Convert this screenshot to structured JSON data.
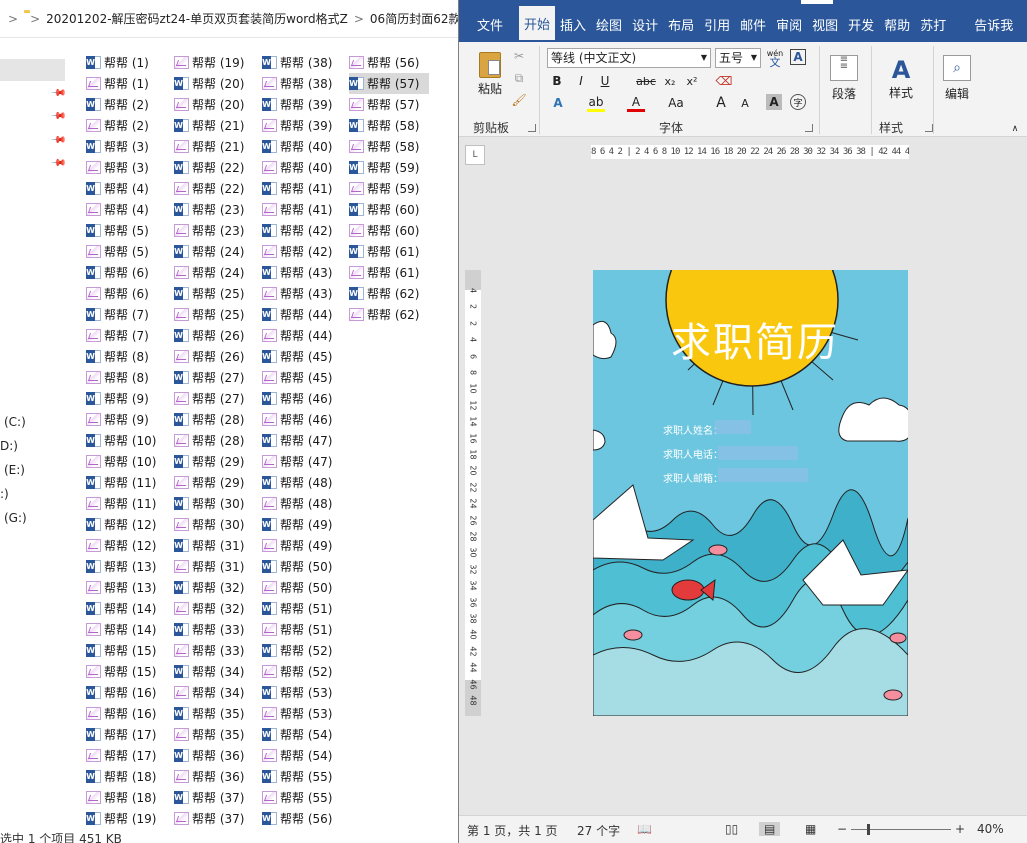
{
  "explorer": {
    "breadcrumb": [
      "20201202-解压密码zt24-单页双页套装简历word格式Z",
      "06简历封面62款"
    ],
    "drives": [
      "(C:)",
      "D:)",
      "(E:)",
      ":)",
      "(G:)"
    ],
    "status_text": "选中 1 个项目  451 KB",
    "columns": [
      [
        {
          "label": "帮帮 (1)",
          "type": "word"
        },
        {
          "label": "帮帮 (1)",
          "type": "image"
        },
        {
          "label": "帮帮 (2)",
          "type": "word"
        },
        {
          "label": "帮帮 (2)",
          "type": "image"
        },
        {
          "label": "帮帮 (3)",
          "type": "word"
        },
        {
          "label": "帮帮 (3)",
          "type": "image"
        },
        {
          "label": "帮帮 (4)",
          "type": "word"
        },
        {
          "label": "帮帮 (4)",
          "type": "image"
        },
        {
          "label": "帮帮 (5)",
          "type": "word"
        },
        {
          "label": "帮帮 (5)",
          "type": "image"
        },
        {
          "label": "帮帮 (6)",
          "type": "word"
        },
        {
          "label": "帮帮 (6)",
          "type": "image"
        },
        {
          "label": "帮帮 (7)",
          "type": "word"
        },
        {
          "label": "帮帮 (7)",
          "type": "image"
        },
        {
          "label": "帮帮 (8)",
          "type": "word"
        },
        {
          "label": "帮帮 (8)",
          "type": "image"
        },
        {
          "label": "帮帮 (9)",
          "type": "word"
        },
        {
          "label": "帮帮 (9)",
          "type": "image"
        },
        {
          "label": "帮帮 (10)",
          "type": "word"
        },
        {
          "label": "帮帮 (10)",
          "type": "image"
        },
        {
          "label": "帮帮 (11)",
          "type": "word"
        },
        {
          "label": "帮帮 (11)",
          "type": "image"
        },
        {
          "label": "帮帮 (12)",
          "type": "word"
        },
        {
          "label": "帮帮 (12)",
          "type": "image"
        },
        {
          "label": "帮帮 (13)",
          "type": "word"
        },
        {
          "label": "帮帮 (13)",
          "type": "image"
        },
        {
          "label": "帮帮 (14)",
          "type": "word"
        },
        {
          "label": "帮帮 (14)",
          "type": "image"
        },
        {
          "label": "帮帮 (15)",
          "type": "word"
        },
        {
          "label": "帮帮 (15)",
          "type": "image"
        },
        {
          "label": "帮帮 (16)",
          "type": "word"
        },
        {
          "label": "帮帮 (16)",
          "type": "image"
        },
        {
          "label": "帮帮 (17)",
          "type": "word"
        },
        {
          "label": "帮帮 (17)",
          "type": "image"
        },
        {
          "label": "帮帮 (18)",
          "type": "word"
        },
        {
          "label": "帮帮 (18)",
          "type": "image"
        },
        {
          "label": "帮帮 (19)",
          "type": "word"
        }
      ],
      [
        {
          "label": "帮帮 (19)",
          "type": "image"
        },
        {
          "label": "帮帮 (20)",
          "type": "word"
        },
        {
          "label": "帮帮 (20)",
          "type": "image"
        },
        {
          "label": "帮帮 (21)",
          "type": "word"
        },
        {
          "label": "帮帮 (21)",
          "type": "image"
        },
        {
          "label": "帮帮 (22)",
          "type": "word"
        },
        {
          "label": "帮帮 (22)",
          "type": "image"
        },
        {
          "label": "帮帮 (23)",
          "type": "word"
        },
        {
          "label": "帮帮 (23)",
          "type": "image"
        },
        {
          "label": "帮帮 (24)",
          "type": "word"
        },
        {
          "label": "帮帮 (24)",
          "type": "image"
        },
        {
          "label": "帮帮 (25)",
          "type": "word"
        },
        {
          "label": "帮帮 (25)",
          "type": "image"
        },
        {
          "label": "帮帮 (26)",
          "type": "word"
        },
        {
          "label": "帮帮 (26)",
          "type": "image"
        },
        {
          "label": "帮帮 (27)",
          "type": "word"
        },
        {
          "label": "帮帮 (27)",
          "type": "image"
        },
        {
          "label": "帮帮 (28)",
          "type": "word"
        },
        {
          "label": "帮帮 (28)",
          "type": "image"
        },
        {
          "label": "帮帮 (29)",
          "type": "word"
        },
        {
          "label": "帮帮 (29)",
          "type": "image"
        },
        {
          "label": "帮帮 (30)",
          "type": "word"
        },
        {
          "label": "帮帮 (30)",
          "type": "image"
        },
        {
          "label": "帮帮 (31)",
          "type": "word"
        },
        {
          "label": "帮帮 (31)",
          "type": "image"
        },
        {
          "label": "帮帮 (32)",
          "type": "word"
        },
        {
          "label": "帮帮 (32)",
          "type": "image"
        },
        {
          "label": "帮帮 (33)",
          "type": "word"
        },
        {
          "label": "帮帮 (33)",
          "type": "image"
        },
        {
          "label": "帮帮 (34)",
          "type": "word"
        },
        {
          "label": "帮帮 (34)",
          "type": "image"
        },
        {
          "label": "帮帮 (35)",
          "type": "word"
        },
        {
          "label": "帮帮 (35)",
          "type": "image"
        },
        {
          "label": "帮帮 (36)",
          "type": "word"
        },
        {
          "label": "帮帮 (36)",
          "type": "image"
        },
        {
          "label": "帮帮 (37)",
          "type": "word"
        },
        {
          "label": "帮帮 (37)",
          "type": "image"
        }
      ],
      [
        {
          "label": "帮帮 (38)",
          "type": "word"
        },
        {
          "label": "帮帮 (38)",
          "type": "image"
        },
        {
          "label": "帮帮 (39)",
          "type": "word"
        },
        {
          "label": "帮帮 (39)",
          "type": "image"
        },
        {
          "label": "帮帮 (40)",
          "type": "word"
        },
        {
          "label": "帮帮 (40)",
          "type": "image"
        },
        {
          "label": "帮帮 (41)",
          "type": "word"
        },
        {
          "label": "帮帮 (41)",
          "type": "image"
        },
        {
          "label": "帮帮 (42)",
          "type": "word"
        },
        {
          "label": "帮帮 (42)",
          "type": "image"
        },
        {
          "label": "帮帮 (43)",
          "type": "word"
        },
        {
          "label": "帮帮 (43)",
          "type": "image"
        },
        {
          "label": "帮帮 (44)",
          "type": "word"
        },
        {
          "label": "帮帮 (44)",
          "type": "image"
        },
        {
          "label": "帮帮 (45)",
          "type": "word"
        },
        {
          "label": "帮帮 (45)",
          "type": "image"
        },
        {
          "label": "帮帮 (46)",
          "type": "word"
        },
        {
          "label": "帮帮 (46)",
          "type": "image"
        },
        {
          "label": "帮帮 (47)",
          "type": "word"
        },
        {
          "label": "帮帮 (47)",
          "type": "image"
        },
        {
          "label": "帮帮 (48)",
          "type": "word"
        },
        {
          "label": "帮帮 (48)",
          "type": "image"
        },
        {
          "label": "帮帮 (49)",
          "type": "word"
        },
        {
          "label": "帮帮 (49)",
          "type": "image"
        },
        {
          "label": "帮帮 (50)",
          "type": "word"
        },
        {
          "label": "帮帮 (50)",
          "type": "image"
        },
        {
          "label": "帮帮 (51)",
          "type": "word"
        },
        {
          "label": "帮帮 (51)",
          "type": "image"
        },
        {
          "label": "帮帮 (52)",
          "type": "word"
        },
        {
          "label": "帮帮 (52)",
          "type": "image"
        },
        {
          "label": "帮帮 (53)",
          "type": "word"
        },
        {
          "label": "帮帮 (53)",
          "type": "image"
        },
        {
          "label": "帮帮 (54)",
          "type": "word"
        },
        {
          "label": "帮帮 (54)",
          "type": "image"
        },
        {
          "label": "帮帮 (55)",
          "type": "word"
        },
        {
          "label": "帮帮 (55)",
          "type": "image"
        },
        {
          "label": "帮帮 (56)",
          "type": "word"
        }
      ],
      [
        {
          "label": "帮帮 (56)",
          "type": "image"
        },
        {
          "label": "帮帮 (57)",
          "type": "word",
          "selected": true
        },
        {
          "label": "帮帮 (57)",
          "type": "image"
        },
        {
          "label": "帮帮 (58)",
          "type": "word"
        },
        {
          "label": "帮帮 (58)",
          "type": "image"
        },
        {
          "label": "帮帮 (59)",
          "type": "word"
        },
        {
          "label": "帮帮 (59)",
          "type": "image"
        },
        {
          "label": "帮帮 (60)",
          "type": "word"
        },
        {
          "label": "帮帮 (60)",
          "type": "image"
        },
        {
          "label": "帮帮 (61)",
          "type": "word"
        },
        {
          "label": "帮帮 (61)",
          "type": "image"
        },
        {
          "label": "帮帮 (62)",
          "type": "word"
        },
        {
          "label": "帮帮 (62)",
          "type": "image"
        }
      ]
    ]
  },
  "word": {
    "tabs": [
      "文件",
      "开始",
      "插入",
      "绘图",
      "设计",
      "布局",
      "引用",
      "邮件",
      "审阅",
      "视图",
      "开发",
      "帮助",
      "苏打",
      "告诉我"
    ],
    "active_tab": "开始",
    "ribbon": {
      "paste_label": "粘贴",
      "clipboard_label": "剪贴板",
      "font_name": "等线 (中文正文)",
      "font_size": "五号",
      "font_group_label": "字体",
      "paragraph_label": "段落",
      "styles_label": "样式",
      "styles_group_label": "样式",
      "edit_label": "编辑",
      "wen_label": "wén",
      "wen_char": "文",
      "bold": "B",
      "italic": "I",
      "underline": "U",
      "strike": "abc",
      "subscript": "x₂",
      "superscript": "x²",
      "case": "Aa",
      "grow_font": "A",
      "shrink_font": "A"
    },
    "ruler": {
      "h_labels": "8 6 4 2 | 2 4 6 8 10 12 14 16 18 20 22 24 26 28 30 32 34 36 38 | 42 44 46 48",
      "v_labels": [
        "4",
        "2",
        "2",
        "4",
        "6",
        "8",
        "10",
        "12",
        "14",
        "16",
        "18",
        "20",
        "22",
        "24",
        "26",
        "28",
        "30",
        "32",
        "34",
        "36",
        "38",
        "40",
        "42",
        "44",
        "46",
        "48"
      ]
    },
    "page": {
      "title": "求职简历",
      "name_label": "求职人姓名：",
      "phone_label": "求职人电话：",
      "email_label": "求职人邮箱："
    },
    "statusbar": {
      "page_info": "第 1 页，共 1 页",
      "word_count": "27 个字",
      "zoom": "40%"
    },
    "colors": {
      "accent": "#2b579a",
      "sky": "#6cc6e0",
      "sun": "#f9c80e",
      "sea": "#3fb0c9"
    }
  }
}
